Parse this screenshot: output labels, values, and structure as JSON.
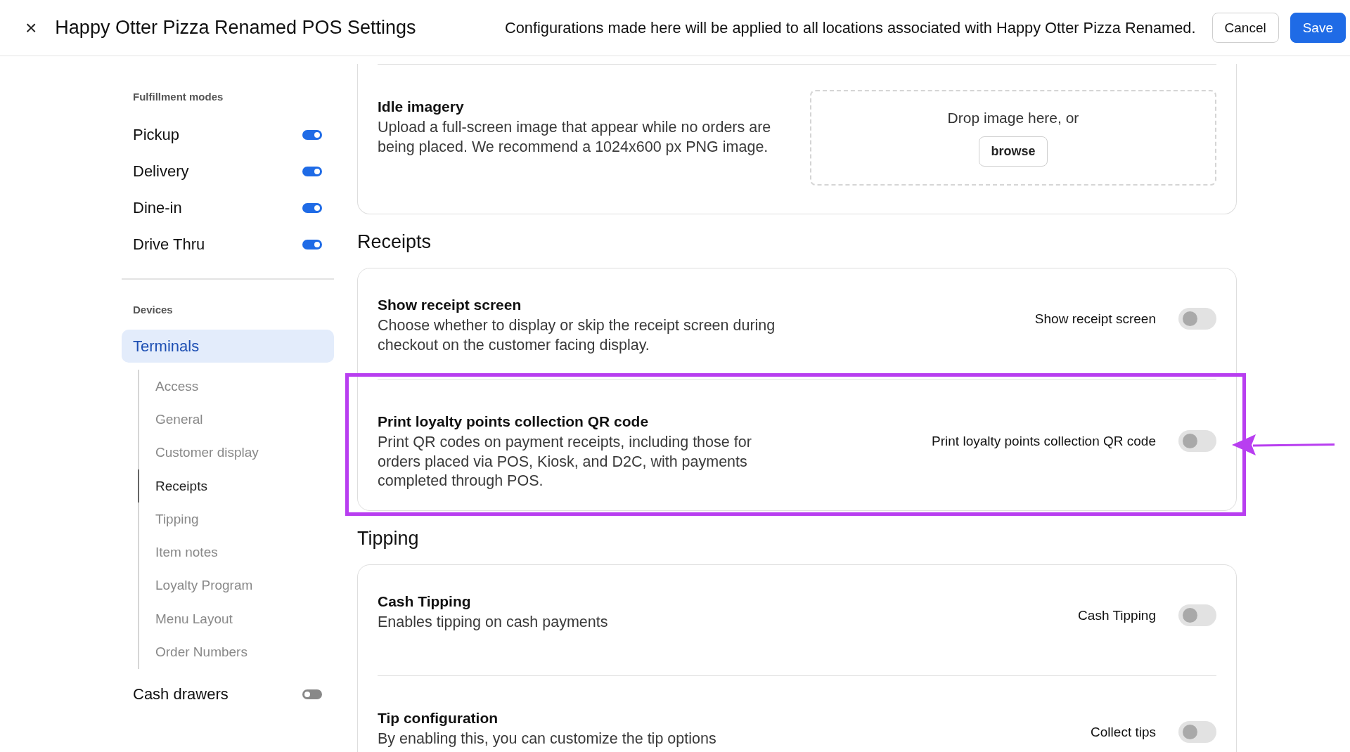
{
  "header": {
    "close": "×",
    "title": "Happy Otter Pizza Renamed POS Settings",
    "notice": "Configurations made here will be applied to all locations associated with Happy Otter Pizza Renamed.",
    "buttons": [
      {
        "label": "Cancel",
        "kind": "secondary"
      },
      {
        "label": "Save",
        "kind": "primary"
      }
    ]
  },
  "sidebar": {
    "groups": [
      {
        "label": "Fulfillment modes",
        "items": [
          {
            "label": "Pickup",
            "kind": "toggle",
            "on": true
          },
          {
            "label": "Delivery",
            "kind": "toggle",
            "on": true
          },
          {
            "label": "Dine-in",
            "kind": "toggle",
            "on": true
          },
          {
            "label": "Drive Thru",
            "kind": "toggle",
            "on": true
          }
        ]
      },
      {
        "label": "Devices",
        "items": [
          {
            "label": "Terminals",
            "kind": "nav",
            "selected": true,
            "children": [
              {
                "label": "Access",
                "selected": false
              },
              {
                "label": "General",
                "selected": false
              },
              {
                "label": "Customer display",
                "selected": false
              },
              {
                "label": "Receipts",
                "selected": true
              },
              {
                "label": "Tipping",
                "selected": false
              },
              {
                "label": "Item notes",
                "selected": false
              },
              {
                "label": "Loyalty Program",
                "selected": false
              },
              {
                "label": "Menu Layout",
                "selected": false
              },
              {
                "label": "Order Numbers",
                "selected": false
              }
            ]
          },
          {
            "label": "Cash drawers",
            "kind": "toggle",
            "on": false
          }
        ]
      }
    ]
  },
  "sections": [
    {
      "items": [
        {
          "kind": "upload",
          "title": "Idle imagery",
          "description": "Upload a full-screen image that appear while no orders are being placed. We recommend a 1024x600 px PNG image.",
          "drop_text": "Drop image here, or",
          "button": "browse"
        }
      ]
    },
    {
      "heading": "Receipts",
      "items": [
        {
          "kind": "toggle",
          "title": "Show receipt screen",
          "description": "Choose whether to display or skip the receipt screen during checkout on the customer facing display.",
          "toggle_label": "Show receipt screen",
          "on": false,
          "highlighted": false
        },
        {
          "kind": "toggle",
          "title": "Print loyalty points collection QR code",
          "description": "Print QR codes on payment receipts, including those for orders placed via POS, Kiosk, and D2C, with payments completed through POS.",
          "toggle_label": "Print loyalty points collection QR code",
          "on": false,
          "highlighted": true
        }
      ]
    },
    {
      "heading": "Tipping",
      "items": [
        {
          "kind": "toggle",
          "title": "Cash Tipping",
          "description": "Enables tipping on cash payments",
          "toggle_label": "Cash Tipping",
          "on": false,
          "highlighted": false
        },
        {
          "kind": "toggle",
          "title": "Tip configuration",
          "description": "By enabling this, you can customize the tip options",
          "toggle_label": "Collect tips",
          "on": false,
          "highlighted": false
        }
      ]
    }
  ]
}
